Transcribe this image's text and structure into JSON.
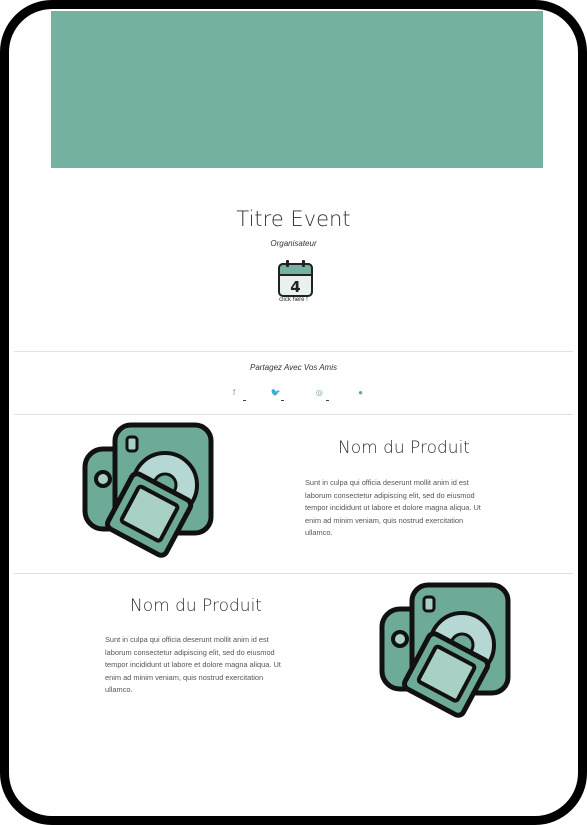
{
  "event": {
    "title": "Titre Event",
    "organizer": "Organisateur",
    "calendar_day": "4",
    "calendar_link": "click here !"
  },
  "share": {
    "heading": "Partagez Avec Vos Amis",
    "socials": [
      {
        "icon": "facebook-icon",
        "glyph": "f"
      },
      {
        "icon": "twitter-icon",
        "glyph": "🐦"
      },
      {
        "icon": "instagram-icon",
        "glyph": "◎"
      },
      {
        "icon": "other-social-icon",
        "glyph": "●"
      }
    ]
  },
  "products": [
    {
      "name": "Nom du Produit",
      "description": "Sunt in culpa qui officia deserunt mollit anim id est laborum consectetur adipiscing elit, sed do eiusmod tempor incididunt ut labore et dolore magna aliqua. Ut enim ad minim veniam, quis nostrud exercitation ullamco.",
      "image": "camera-icon"
    },
    {
      "name": "Nom du Produit",
      "description": "Sunt in culpa qui officia deserunt mollit anim id est laborum consectetur adipiscing elit, sed do eiusmod tempor incididunt ut labore et dolore magna aliqua. Ut enim ad minim veniam, quis nostrud exercitation ullamco.",
      "image": "camera-icon"
    }
  ],
  "colors": {
    "banner": "#75b1a1",
    "accent": "#6fa796"
  }
}
